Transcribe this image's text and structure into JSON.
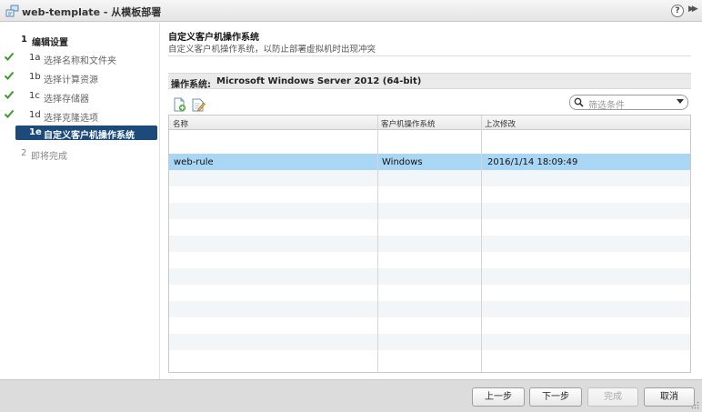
{
  "window": {
    "title": "web-template - 从模板部署",
    "help_symbol": "?"
  },
  "steps": [
    {
      "num": "1",
      "label": "编辑设置",
      "state": "parent"
    },
    {
      "num": "1a",
      "label": "选择名称和文件夹",
      "state": "done"
    },
    {
      "num": "1b",
      "label": "选择计算资源",
      "state": "done"
    },
    {
      "num": "1c",
      "label": "选择存储器",
      "state": "done"
    },
    {
      "num": "1d",
      "label": "选择克隆选项",
      "state": "done"
    },
    {
      "num": "1e",
      "label": "自定义客户机操作系统",
      "state": "active"
    },
    {
      "num": "2",
      "label": "即将完成",
      "state": "pending"
    }
  ],
  "page": {
    "title": "自定义客户机操作系统",
    "description": "自定义客户机操作系统，以防止部署虚拟机时出现冲突"
  },
  "os": {
    "label": "操作系统:",
    "value": "Microsoft Windows Server 2012 (64-bit)"
  },
  "toolbar": {
    "new_icon": "new-spec-icon",
    "edit_icon": "edit-spec-icon"
  },
  "filter": {
    "placeholder": "筛选条件"
  },
  "grid": {
    "columns": [
      "名称",
      "客户机操作系统",
      "上次修改"
    ],
    "rows": [
      {
        "name": "web-rule",
        "os": "Windows",
        "modified": "2016/1/14 18:09:49",
        "selected": true
      }
    ]
  },
  "buttons": {
    "back": "上一步",
    "next": "下一步",
    "finish": "完成",
    "cancel": "取消"
  },
  "colors": {
    "active_step": "#1c4a7a",
    "selected_row": "#a9d6f5",
    "check": "#3a9a2a"
  }
}
